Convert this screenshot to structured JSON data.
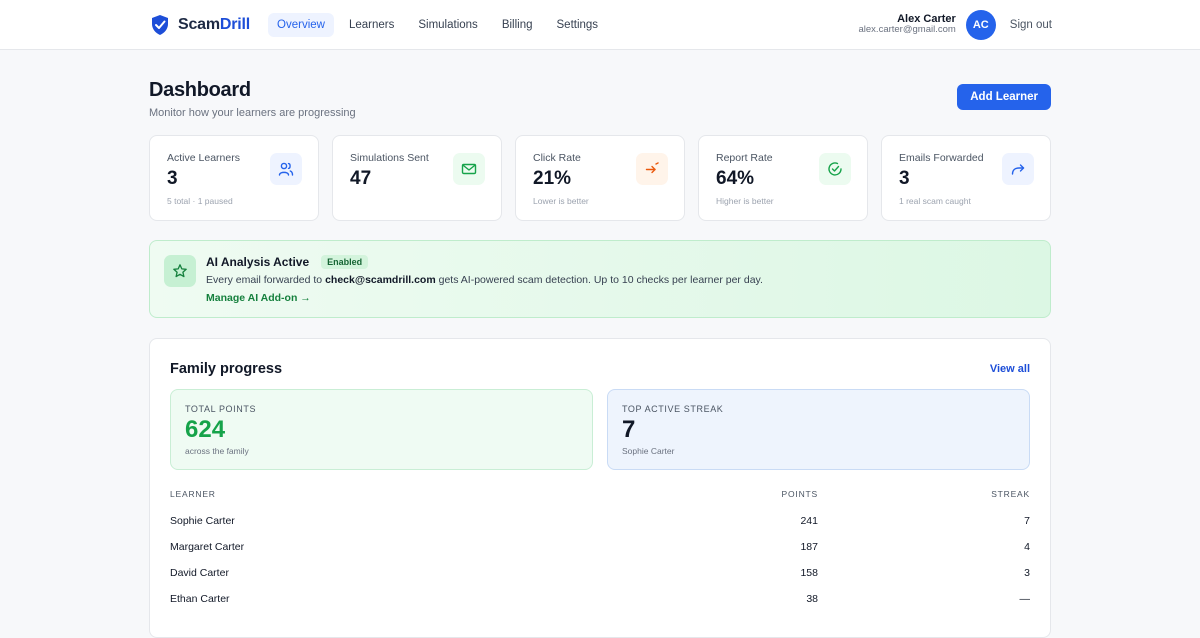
{
  "brand": {
    "name_part1": "Scam",
    "name_part2": "Drill",
    "accent_color": "#1d4ed8",
    "icon": "shield-check-icon"
  },
  "nav": {
    "items": [
      {
        "label": "Overview",
        "active": true
      },
      {
        "label": "Learners",
        "active": false
      },
      {
        "label": "Simulations",
        "active": false
      },
      {
        "label": "Billing",
        "active": false
      },
      {
        "label": "Settings",
        "active": false
      }
    ]
  },
  "user": {
    "name": "Alex Carter",
    "email": "alex.carter@gmail.com",
    "initials": "AC",
    "sign_out": "Sign out"
  },
  "page": {
    "title": "Dashboard",
    "subtitle": "Monitor how your learners are progressing",
    "add_button": "Add Learner"
  },
  "stats": [
    {
      "label": "Active Learners",
      "value": "3",
      "note": "5 total · 1 paused",
      "icon": "users-icon",
      "icon_color": "#2563eb",
      "icon_bg": "#eef3ff"
    },
    {
      "label": "Simulations Sent",
      "value": "47",
      "note": "",
      "icon": "mail-icon",
      "icon_color": "#16a34a",
      "icon_bg": "#ecfbf0"
    },
    {
      "label": "Click Rate",
      "value": "21%",
      "note": "Lower is better",
      "icon": "arrow-click-icon",
      "icon_color": "#ea580c",
      "icon_bg": "#fff4ea"
    },
    {
      "label": "Report Rate",
      "value": "64%",
      "note": "Higher is better",
      "icon": "check-circle-icon",
      "icon_color": "#16a34a",
      "icon_bg": "#ecfbf0"
    },
    {
      "label": "Emails Forwarded",
      "value": "3",
      "note": "1 real scam caught",
      "icon": "forward-icon",
      "icon_color": "#2563eb",
      "icon_bg": "#eef3ff"
    }
  ],
  "ai": {
    "title": "AI Analysis Active",
    "badge": "Enabled",
    "desc_before": "Every email forwarded to ",
    "desc_email": "check@scamdrill.com",
    "desc_after": " gets AI-powered scam detection. Up to 10 checks per learner per day.",
    "link": "Manage AI Add-on →",
    "icon": "star-icon"
  },
  "family": {
    "title": "Family progress",
    "view_all": "View all",
    "total_points_label": "TOTAL POINTS",
    "total_points_value": "624",
    "total_points_note": "across the family",
    "streak_label": "TOP ACTIVE STREAK",
    "streak_value": "7",
    "streak_note": "Sophie Carter",
    "columns": {
      "learner": "LEARNER",
      "points": "POINTS",
      "streak": "STREAK"
    },
    "rows": [
      {
        "name": "Sophie Carter",
        "points": "241",
        "streak": "7"
      },
      {
        "name": "Margaret Carter",
        "points": "187",
        "streak": "4"
      },
      {
        "name": "David Carter",
        "points": "158",
        "streak": "3"
      },
      {
        "name": "Ethan Carter",
        "points": "38",
        "streak": "—"
      }
    ]
  }
}
